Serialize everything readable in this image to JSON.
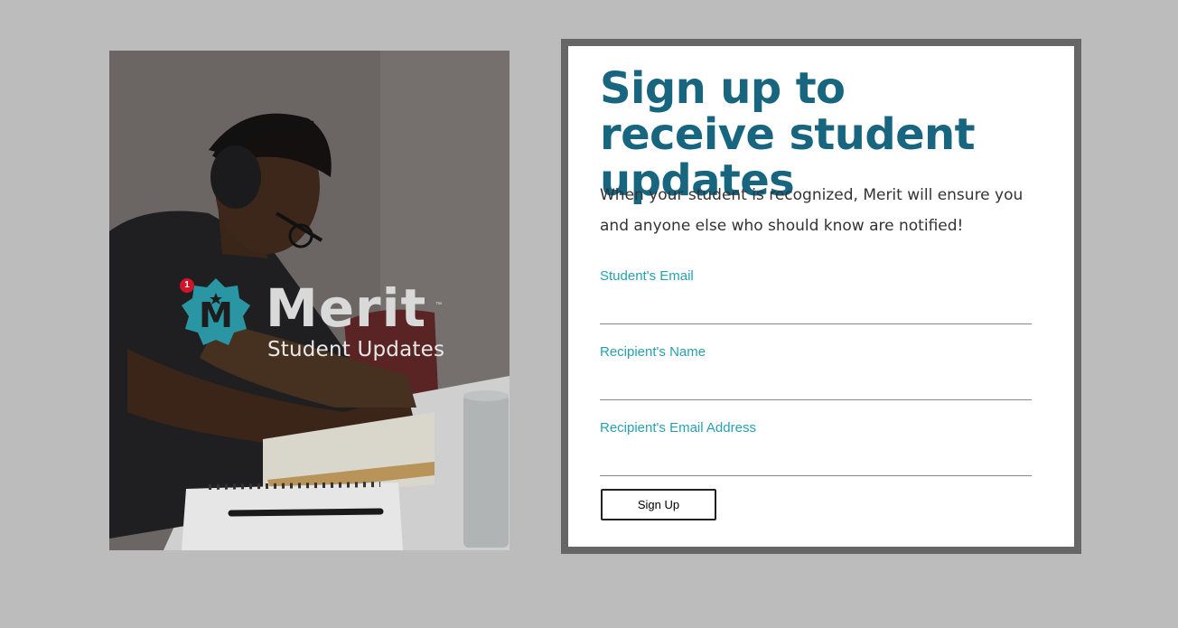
{
  "hero": {
    "image_alt": "Student with headphones studying at a desk",
    "logo": {
      "brand": "Merit",
      "trademark": "™",
      "subtitle": "Student Updates",
      "badge_letter": "M",
      "badge_color": "#2a96a4",
      "notification_count": "1",
      "notification_color": "#d0142a"
    }
  },
  "form": {
    "title": "Sign up to receive student updates",
    "description": "When your student is recognized, Merit will ensure you and anyone else who should know are notified!",
    "fields": [
      {
        "label": "Student's Email",
        "value": "",
        "placeholder": ""
      },
      {
        "label": "Recipient's Name",
        "value": "",
        "placeholder": ""
      },
      {
        "label": "Recipient's Email Address",
        "value": "",
        "placeholder": ""
      }
    ],
    "submit_label": "Sign Up"
  },
  "colors": {
    "page_bg": "#bcbcbc",
    "title": "#17657e",
    "field_label": "#27a1b1",
    "card_border": "#666666"
  }
}
